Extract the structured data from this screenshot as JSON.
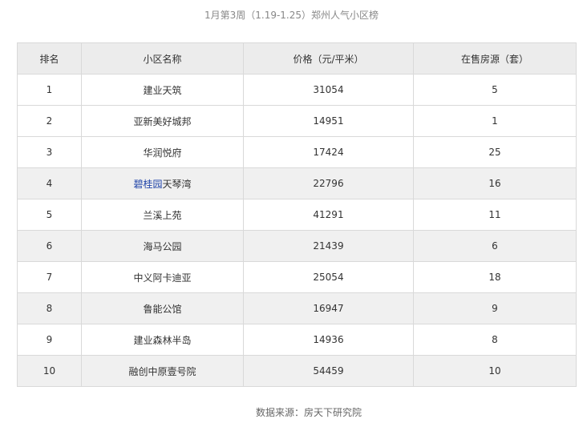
{
  "caption": "1月第3周（1.19-1.25）郑州人气小区榜",
  "table": {
    "headers": [
      "排名",
      "小区名称",
      "价格（元/平米）",
      "在售房源（套）"
    ],
    "rows": [
      {
        "rank": "1",
        "name_link": "",
        "name": "建业天筑",
        "price": "31054",
        "listings": "5"
      },
      {
        "rank": "2",
        "name_link": "",
        "name": "亚新美好城邦",
        "price": "14951",
        "listings": "1"
      },
      {
        "rank": "3",
        "name_link": "",
        "name": "华润悦府",
        "price": "17424",
        "listings": "25"
      },
      {
        "rank": "4",
        "name_link": "碧桂园",
        "name": "天琴湾",
        "price": "22796",
        "listings": "16"
      },
      {
        "rank": "5",
        "name_link": "",
        "name": "兰溪上苑",
        "price": "41291",
        "listings": "11"
      },
      {
        "rank": "6",
        "name_link": "",
        "name": "海马公园",
        "price": "21439",
        "listings": "6"
      },
      {
        "rank": "7",
        "name_link": "",
        "name": "中义阿卡迪亚",
        "price": "25054",
        "listings": "18"
      },
      {
        "rank": "8",
        "name_link": "",
        "name": "鲁能公馆",
        "price": "16947",
        "listings": "9"
      },
      {
        "rank": "9",
        "name_link": "",
        "name": "建业森林半岛",
        "price": "14936",
        "listings": "8"
      },
      {
        "rank": "10",
        "name_link": "",
        "name": "融创中原壹号院",
        "price": "54459",
        "listings": "10"
      }
    ]
  },
  "source": "数据来源：房天下研究院"
}
